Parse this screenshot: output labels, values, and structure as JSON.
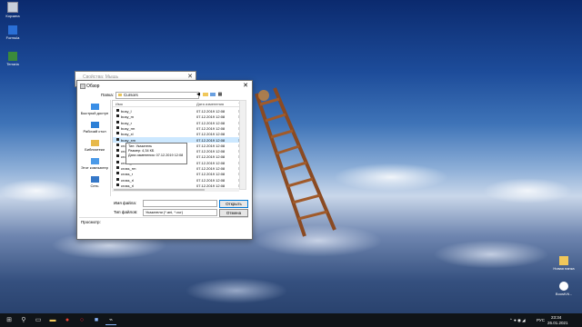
{
  "desktop": {
    "icons": [
      {
        "label": "Корзина"
      },
      {
        "label": "Formula"
      },
      {
        "label": "Terraria"
      }
    ],
    "right_icons": [
      {
        "label": "Новая папка"
      },
      {
        "label": "BoostVit..."
      }
    ]
  },
  "props_window": {
    "title": "Свойства: Мышь",
    "close": "✕"
  },
  "dialog": {
    "title": "Обзор",
    "close": "✕",
    "look_in_label": "Папка:",
    "look_in_value": "Cursors",
    "places": [
      {
        "label": "Быстрый доступ",
        "icon": "star-icon"
      },
      {
        "label": "Рабочий стол",
        "icon": "desktop-icon"
      },
      {
        "label": "Библиотеки",
        "icon": "library-icon"
      },
      {
        "label": "Этот компьютер",
        "icon": "computer-icon"
      },
      {
        "label": "Сеть",
        "icon": "network-icon"
      }
    ],
    "columns": {
      "name": "Имя",
      "date": "Дата изменения",
      "type": "Ти"
    },
    "files": [
      {
        "name": "busy_l",
        "date": "07.12.2019 12:08",
        "type": "Ун"
      },
      {
        "name": "busy_m",
        "date": "07.12.2019 12:08",
        "type": "Ун"
      },
      {
        "name": "busy_r",
        "date": "07.12.2019 12:08",
        "type": "Ун"
      },
      {
        "name": "busy_rm",
        "date": "07.12.2019 12:08",
        "type": "Ун"
      },
      {
        "name": "busy_xl",
        "date": "07.12.2019 12:08",
        "type": "Ун"
      },
      {
        "name": "busy_xm",
        "date": "07.12.2019 12:08",
        "type": "Ун"
      },
      {
        "name": "cross_l",
        "date": "07.12.2019 12:08",
        "type": "Ун"
      },
      {
        "name": "cross_m",
        "date": "07.12.2019 12:08",
        "type": "Ун"
      },
      {
        "name": "cross_r",
        "date": "07.12.2019 12:08",
        "type": "Ун"
      },
      {
        "name": "cross_rl",
        "date": "07.12.2019 12:08",
        "type": "Ун"
      },
      {
        "name": "cross_rm",
        "date": "07.12.2019 12:08",
        "type": "Ун"
      },
      {
        "name": "cross_r",
        "date": "07.12.2019 12:08",
        "type": "Ун"
      },
      {
        "name": "cross_rl",
        "date": "07.12.2019 12:08",
        "type": "Ун"
      },
      {
        "name": "cross_rl",
        "date": "07.12.2019 12:08",
        "type": "Ун"
      }
    ],
    "selected_index": 5,
    "filename_label": "Имя файла:",
    "filename_value": "",
    "filetype_label": "Тип файлов:",
    "filetype_value": "Указатели (*.ani, *.cur)",
    "open_button": "Открыть",
    "cancel_button": "Отмена",
    "preview_label": "Просмотр:",
    "tooltip": {
      "line1": "Тип: Указатель",
      "line2": "Размер: 4,34 КБ",
      "line3": "Дата изменения: 07.12.2019 12:08"
    }
  },
  "taskbar": {
    "time": "23:34",
    "date": "26.01.2021",
    "lang": "РУС",
    "pinned": [
      "start-icon",
      "search-icon",
      "taskview-icon",
      "explorer-icon",
      "chrome-icon",
      "opera-icon",
      "store-icon",
      "mouse-settings-icon"
    ]
  }
}
